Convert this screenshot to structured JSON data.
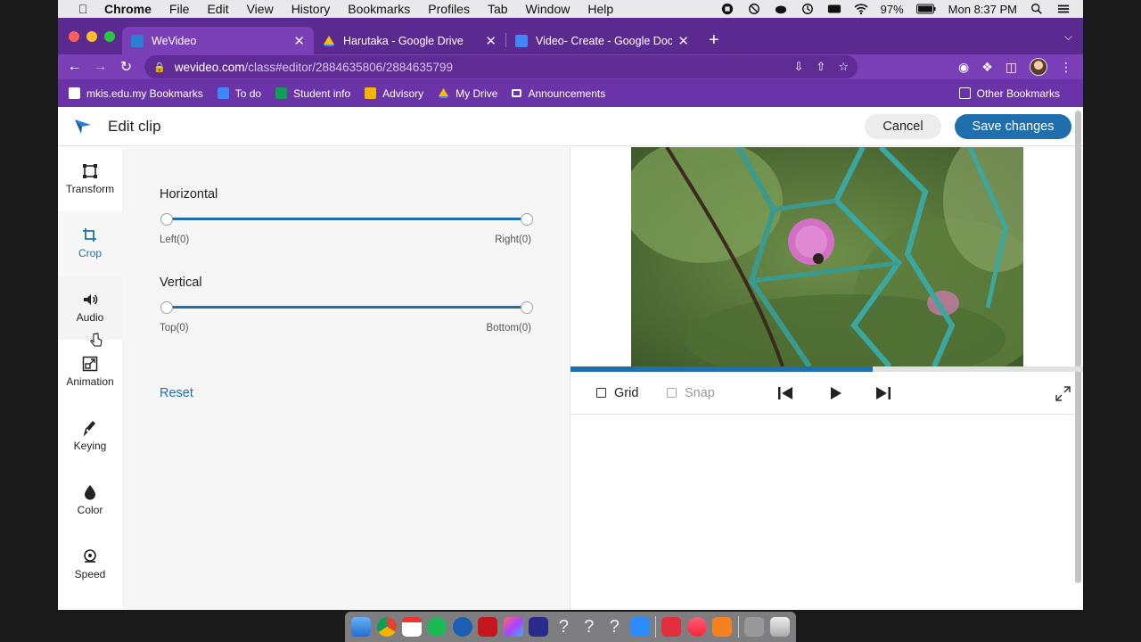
{
  "menubar": {
    "app_name": "Chrome",
    "items": [
      "File",
      "Edit",
      "View",
      "History",
      "Bookmarks",
      "Profiles",
      "Tab",
      "Window",
      "Help"
    ],
    "battery": "97%",
    "clock": "Mon 8:37 PM"
  },
  "tabs": [
    {
      "title": "WeVideo",
      "active": true
    },
    {
      "title": "Harutaka - Google Drive",
      "active": false
    },
    {
      "title": "Video- Create - Google Docs",
      "active": false
    }
  ],
  "address": {
    "host": "wevideo.com",
    "path": "/class#editor/2884635806/2884635799"
  },
  "bookmarks": {
    "items": [
      "mkis.edu.my Bookmarks",
      "To do",
      "Student info",
      "Advisory",
      "My Drive",
      "Announcements"
    ],
    "other": "Other Bookmarks"
  },
  "editor": {
    "title": "Edit clip",
    "cancel_label": "Cancel",
    "save_label": "Save changes"
  },
  "sidebar": {
    "items": [
      {
        "label": "Transform",
        "icon": "transform-icon"
      },
      {
        "label": "Crop",
        "icon": "crop-icon"
      },
      {
        "label": "Audio",
        "icon": "audio-icon"
      },
      {
        "label": "Animation",
        "icon": "animation-icon"
      },
      {
        "label": "Keying",
        "icon": "keying-icon"
      },
      {
        "label": "Color",
        "icon": "color-icon"
      },
      {
        "label": "Speed",
        "icon": "speed-icon"
      }
    ],
    "active_index": 1
  },
  "crop": {
    "horizontal_label": "Horizontal",
    "horizontal_left": "Left(0)",
    "horizontal_right": "Right(0)",
    "vertical_label": "Vertical",
    "vertical_top": "Top(0)",
    "vertical_bottom": "Bottom(0)",
    "reset_label": "Reset"
  },
  "player": {
    "grid_label": "Grid",
    "snap_label": "Snap",
    "progress_percent": 59
  },
  "colors": {
    "accent": "#1f6fae",
    "chrome_purple": "#7a3fb7",
    "tabstrip_purple": "#5b2a91"
  }
}
